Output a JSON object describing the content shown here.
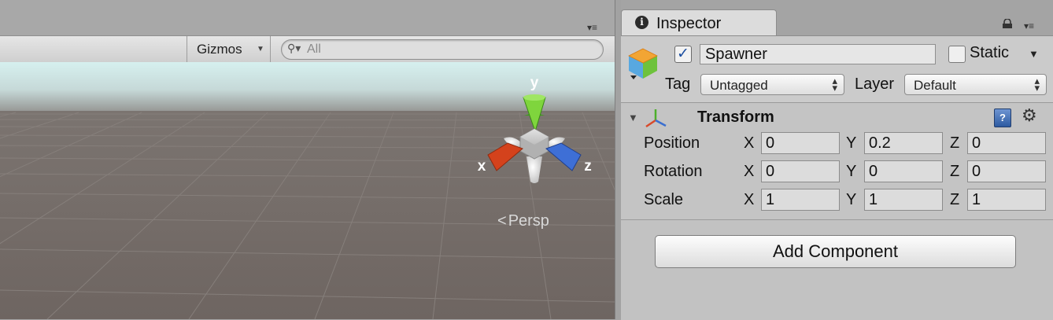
{
  "scene": {
    "gizmos_label": "Gizmos",
    "search_placeholder": "All",
    "axis_labels": {
      "x": "x",
      "y": "y",
      "z": "z"
    },
    "projection_label": "Persp",
    "sky_color": "#d6f0ef",
    "ground_color": "#6e6561"
  },
  "inspector": {
    "tab_title": "Inspector",
    "game_object": {
      "active": true,
      "name": "Spawner",
      "static": false,
      "static_label": "Static",
      "tag_label": "Tag",
      "tag_value": "Untagged",
      "layer_label": "Layer",
      "layer_value": "Default"
    },
    "transform": {
      "title": "Transform",
      "rows": [
        {
          "label": "Position",
          "x": "0",
          "y": "0.2",
          "z": "0"
        },
        {
          "label": "Rotation",
          "x": "0",
          "y": "0",
          "z": "0"
        },
        {
          "label": "Scale",
          "x": "1",
          "y": "1",
          "z": "1"
        }
      ],
      "axis_names": {
        "x": "X",
        "y": "Y",
        "z": "Z"
      }
    },
    "add_component_label": "Add Component"
  }
}
